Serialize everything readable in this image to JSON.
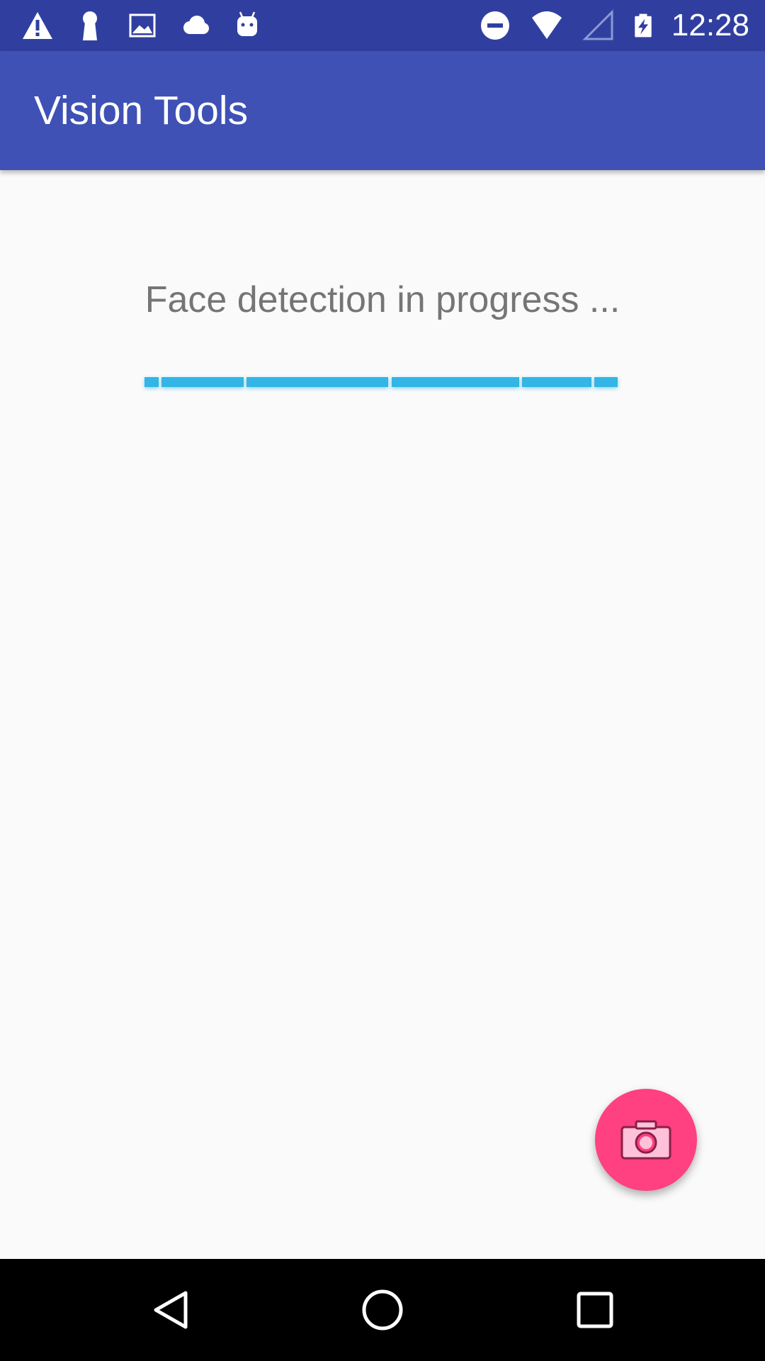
{
  "status_bar": {
    "time": "12:28",
    "icons_left": [
      "warning-icon",
      "keyhole-icon",
      "image-icon",
      "cloud-icon",
      "android-icon"
    ],
    "icons_right": [
      "do-not-disturb-icon",
      "wifi-icon",
      "cell-signal-icon",
      "battery-charging-icon"
    ]
  },
  "app_bar": {
    "title": "Vision Tools"
  },
  "main": {
    "progress_text": "Face detection in progress ...",
    "progress_color": "#33b5e5"
  },
  "fab": {
    "icon": "camera-icon",
    "color": "#ff4081"
  },
  "nav_bar": {
    "buttons": [
      "back-icon",
      "home-icon",
      "recents-icon"
    ]
  },
  "colors": {
    "status_bar": "#303f9f",
    "app_bar": "#3f51b5",
    "background": "#fafafa"
  }
}
